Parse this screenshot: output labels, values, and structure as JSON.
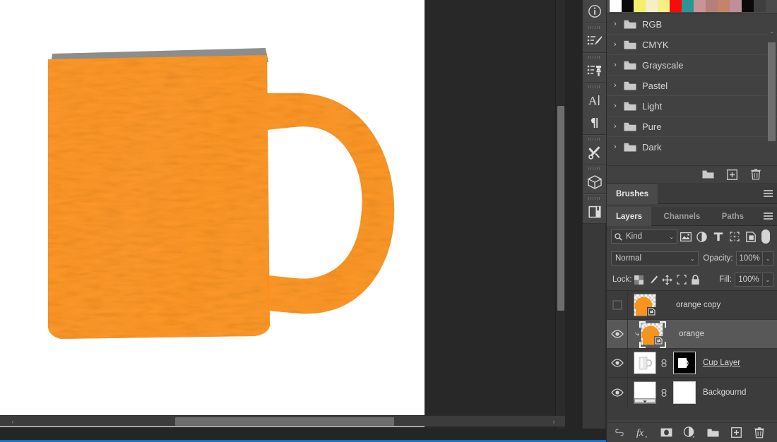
{
  "canvas": {
    "document_background": "#ffffff",
    "workspace_background": "#282828",
    "artwork": {
      "name": "orange-textured-coffee-mug",
      "body_color": "#FF8C1A",
      "texture_color": "#FFA23A",
      "rim_color": "#8a8a8a"
    },
    "scrollbars": {
      "horizontal_left_arrow": "‹",
      "horizontal_right_arrow": "›",
      "vertical_down_arrow": "⌄"
    }
  },
  "rail": {
    "items": [
      {
        "name": "info-icon",
        "label": "Info"
      },
      {
        "name": "brush-presets-icon",
        "label": "Brush Presets"
      },
      {
        "name": "clone-source-icon",
        "label": "Clone Source"
      },
      {
        "name": "character-icon",
        "label": "Character"
      },
      {
        "name": "paragraph-icon",
        "label": "Paragraph"
      },
      {
        "name": "tool-presets-icon",
        "label": "Tool Presets"
      },
      {
        "name": "3d-icon",
        "label": "3D"
      },
      {
        "name": "layer-comps-icon",
        "label": "Layer Comps"
      }
    ]
  },
  "swatches": {
    "colors": [
      "#ffffff",
      "#0a0a0a",
      "#f2ef6f",
      "#f5f0c4",
      "#f5ef84",
      "#fa0a0a",
      "#2f9494",
      "#c79595",
      "#b5807a",
      "#c4836a",
      "#c08f9b",
      "#0a0a0a",
      "#3f3f3f"
    ],
    "groups": [
      {
        "label": "RGB",
        "chevron": "›",
        "expanded": false
      },
      {
        "label": "CMYK",
        "chevron": "›",
        "expanded": false
      },
      {
        "label": "Grayscale",
        "chevron": "›",
        "expanded": false
      },
      {
        "label": "Pastel",
        "chevron": "›",
        "expanded": false
      },
      {
        "label": "Light",
        "chevron": "›",
        "expanded": false
      },
      {
        "label": "Pure",
        "chevron": "›",
        "expanded": false
      },
      {
        "label": "Dark",
        "chevron": "›",
        "expanded": false
      }
    ],
    "scroll_up_arrow": "⌃",
    "scroll_down_arrow": "⌄",
    "footer_buttons": [
      {
        "name": "new-group-button",
        "label": "New Group"
      },
      {
        "name": "new-swatch-button",
        "label": "New Swatch"
      },
      {
        "name": "delete-swatch-button",
        "label": "Delete Swatch"
      }
    ]
  },
  "brushes_panel": {
    "tab_label": "Brushes",
    "menu_label": "Panel Menu"
  },
  "layers_panel": {
    "tabs": [
      {
        "label": "Layers",
        "active": true
      },
      {
        "label": "Channels",
        "active": false
      },
      {
        "label": "Paths",
        "active": false
      }
    ],
    "menu_label": "Panel Menu",
    "filter": {
      "kind_label": "Kind",
      "search_icon": "search-icon",
      "dropdown_caret": "⌄",
      "filter_icons": [
        {
          "name": "filter-pixel-icon",
          "label": "Pixel Layers"
        },
        {
          "name": "filter-adjustment-icon",
          "label": "Adjustment Layers"
        },
        {
          "name": "filter-type-icon",
          "label": "Type Layers"
        },
        {
          "name": "filter-shape-icon",
          "label": "Shape Layers"
        },
        {
          "name": "filter-smartobject-icon",
          "label": "Smart Objects"
        }
      ],
      "toggle_label": "Filtering On/Off"
    },
    "blend_mode": "Normal",
    "opacity_label": "Opacity:",
    "opacity_value": "100%",
    "lock_label": "Lock:",
    "lock_icons": [
      {
        "name": "lock-transparent-pixels-icon",
        "label": "Lock Transparent Pixels"
      },
      {
        "name": "lock-image-pixels-icon",
        "label": "Lock Image Pixels"
      },
      {
        "name": "lock-position-icon",
        "label": "Lock Position"
      },
      {
        "name": "lock-artboard-icon",
        "label": "Prevent Auto-Nesting"
      },
      {
        "name": "lock-all-icon",
        "label": "Lock All"
      }
    ],
    "fill_label": "Fill:",
    "fill_value": "100%",
    "dropdown_caret": "⌄",
    "layers": [
      {
        "name": "orange copy",
        "visible": false,
        "selected": false,
        "clipped": false,
        "thumb_type": "orange-smart-object",
        "has_mask": false,
        "linked": false,
        "underline": false
      },
      {
        "name": "orange",
        "visible": true,
        "selected": true,
        "clipped": true,
        "clip_arrow": "⤷",
        "thumb_type": "orange-smart-object",
        "has_mask": false,
        "linked": false,
        "underline": false
      },
      {
        "name": "Cup Layer ",
        "visible": true,
        "selected": false,
        "clipped": false,
        "thumb_type": "white-mug",
        "has_mask": true,
        "mask_type": "cup-mask",
        "linked": true,
        "underline": true
      },
      {
        "name": "Backgournd",
        "visible": true,
        "selected": false,
        "clipped": false,
        "thumb_type": "gradient-white",
        "has_mask": true,
        "mask_type": "white-mask",
        "linked": true,
        "underline": false
      }
    ],
    "footer_buttons": [
      {
        "name": "link-layers-button",
        "label": "Link layers"
      },
      {
        "name": "layer-style-button",
        "label": "Add a layer style",
        "glyph": "fx"
      },
      {
        "name": "layer-mask-button",
        "label": "Add layer mask"
      },
      {
        "name": "adjustment-layer-button",
        "label": "Create new fill or adjustment layer"
      },
      {
        "name": "new-group-button",
        "label": "Create a new group"
      },
      {
        "name": "new-layer-button",
        "label": "Create a new layer",
        "glyph": "+"
      },
      {
        "name": "delete-layer-button",
        "label": "Delete layer"
      }
    ]
  },
  "accent": {
    "selection_blue": "#1473c8",
    "panel_bg": "#414141",
    "row_selected": "#585858"
  }
}
